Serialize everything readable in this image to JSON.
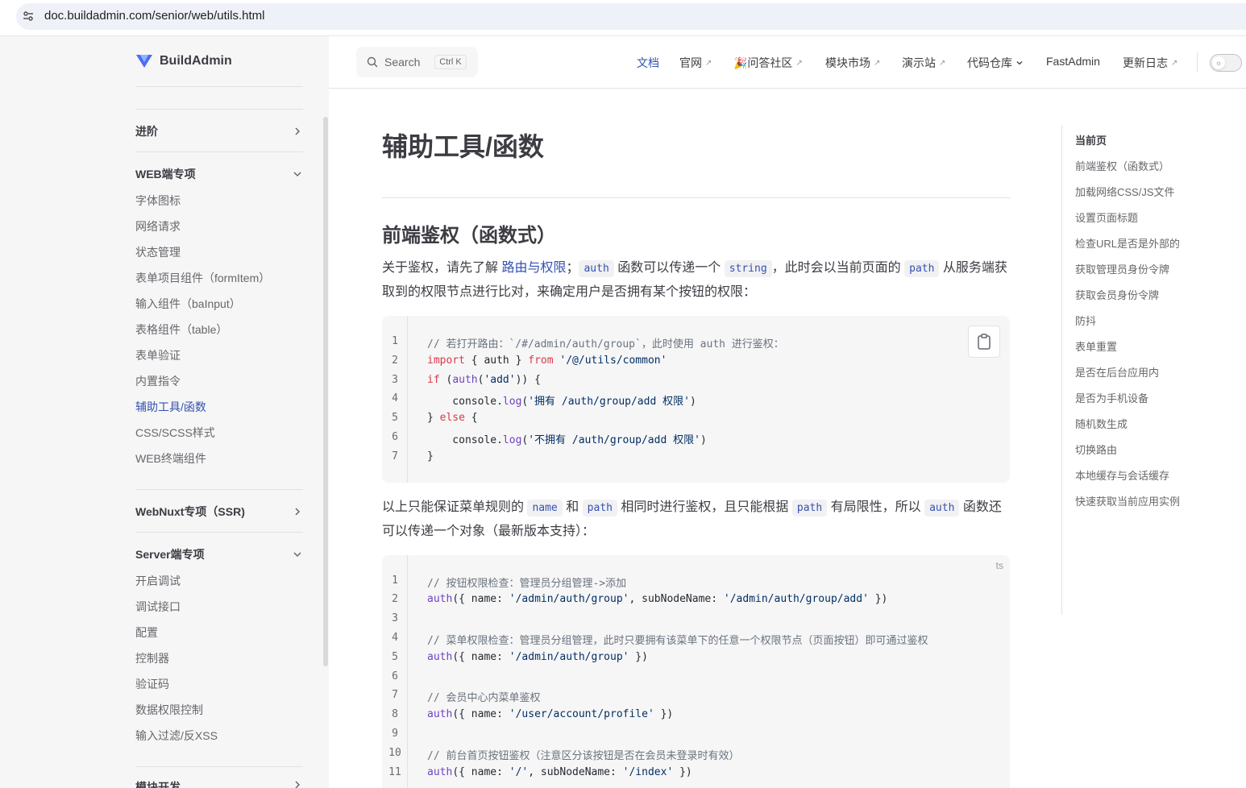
{
  "browser": {
    "url": "doc.buildadmin.com/senior/web/utils.html"
  },
  "colors": {
    "accent": "#3451b2",
    "sidebar_bg": "#f6f6f7",
    "code_bg": "#f6f6f7",
    "text": "#3c3c43",
    "muted": "#67676c"
  },
  "sidebar": {
    "logo_text": "BuildAdmin",
    "sections": [
      {
        "title": "进阶",
        "expanded": false,
        "icon": "chevron-right-icon"
      },
      {
        "title": "WEB端专项",
        "expanded": true,
        "icon": "chevron-down-icon"
      },
      {
        "title": "WebNuxt专项（SSR)",
        "expanded": false,
        "icon": "chevron-right-icon"
      },
      {
        "title": "Server端专项",
        "expanded": true,
        "icon": "chevron-down-icon"
      },
      {
        "title": "模块开发",
        "expanded": false,
        "icon": "chevron-right-icon"
      }
    ],
    "web_items": [
      "字体图标",
      "网络请求",
      "状态管理",
      "表单项目组件（formItem）",
      "输入组件（baInput）",
      "表格组件（table）",
      "表单验证",
      "内置指令",
      "辅助工具/函数",
      "CSS/SCSS样式",
      "WEB终端组件"
    ],
    "server_items": [
      "开启调试",
      "调试接口",
      "配置",
      "控制器",
      "验证码",
      "数据权限控制",
      "输入过滤/反XSS"
    ],
    "active_item": "辅助工具/函数"
  },
  "topnav": {
    "search_label": "Search",
    "search_kbd": "Ctrl K",
    "items": [
      {
        "label": "文档",
        "external": false,
        "active": true
      },
      {
        "label": "官网",
        "external": true
      },
      {
        "label": "🎉问答社区",
        "external": true
      },
      {
        "label": "模块市场",
        "external": true
      },
      {
        "label": "演示站",
        "external": true
      },
      {
        "label": "代码仓库",
        "dropdown": true
      },
      {
        "label": "FastAdmin",
        "external": false
      },
      {
        "label": "更新日志",
        "external": true
      }
    ],
    "ext_glyph": "↗",
    "dropdown_glyph": "⌄"
  },
  "content": {
    "title": "辅助工具/函数",
    "section1_title": "前端鉴权（函数式）",
    "para1": {
      "t1": "关于鉴权，请先了解 ",
      "link": "路由与权限",
      "t2": "；",
      "c1": "auth",
      "t3": " 函数可以传递一个 ",
      "c2": "string",
      "t4": "，此时会以当前页面的 ",
      "c3": "path",
      "t5": " 从服务端获取到的权限节点进行比对，来确定用户是否拥有某个按钮的权限："
    },
    "code1": {
      "lines": [
        "// 若打开路由：`/#/admin/auth/group`，此时使用 auth 进行鉴权：",
        "import { auth } from '/@/utils/common'",
        "if (auth('add')) {",
        "    console.log('拥有 /auth/group/add 权限')",
        "} else {",
        "    console.log('不拥有 /auth/group/add 权限')",
        "}"
      ],
      "line_numbers": [
        "1",
        "2",
        "3",
        "4",
        "5",
        "6",
        "7"
      ]
    },
    "para2": {
      "t1": "以上只能保证菜单规则的 ",
      "c1": "name",
      "t2": " 和 ",
      "c2": "path",
      "t3": " 相同时进行鉴权，且只能根据 ",
      "c3": "path",
      "t4": " 有局限性，所以 ",
      "c4": "auth",
      "t5": " 函数还可以传递一个对象（最新版本支持）："
    },
    "code2": {
      "lang": "ts",
      "line_numbers": [
        "1",
        "2",
        "3",
        "4",
        "5",
        "6",
        "7",
        "8",
        "9",
        "10",
        "11"
      ],
      "lines": [
        "// 按钮权限检查：管理员分组管理->添加",
        "auth({ name: '/admin/auth/group', subNodeName: '/admin/auth/group/add' })",
        "",
        "// 菜单权限检查：管理员分组管理，此时只要拥有该菜单下的任意一个权限节点（页面按钮）即可通过鉴权",
        "auth({ name: '/admin/auth/group' })",
        "",
        "// 会员中心内菜单鉴权",
        "auth({ name: '/user/account/profile' })",
        "",
        "// 前台首页按钮鉴权（注意区分该按钮是否在会员未登录时有效）",
        "auth({ name: '/', subNodeName: '/index' })"
      ]
    }
  },
  "toc": {
    "title": "当前页",
    "items": [
      "前端鉴权（函数式）",
      "加载网络CSS/JS文件",
      "设置页面标题",
      "检查URL是否是外部的",
      "获取管理员身份令牌",
      "获取会员身份令牌",
      "防抖",
      "表单重置",
      "是否在后台应用内",
      "是否为手机设备",
      "随机数生成",
      "切换路由",
      "本地缓存与会话缓存",
      "快速获取当前应用实例"
    ]
  }
}
